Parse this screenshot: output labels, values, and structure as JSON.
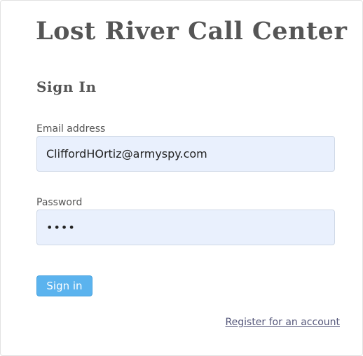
{
  "header": {
    "title": "Lost River Call Center",
    "subtitle": "Sign In"
  },
  "form": {
    "email_label": "Email address",
    "email_value": "CliffordHOrtiz@armyspy.com",
    "password_label": "Password",
    "password_value": "••••",
    "submit_label": "Sign in"
  },
  "footer": {
    "register_link": "Register for an account"
  },
  "colors": {
    "input_bg": "#e9f0fd",
    "button_bg": "#5bb3ee",
    "heading": "#555555",
    "link": "#55577a"
  }
}
